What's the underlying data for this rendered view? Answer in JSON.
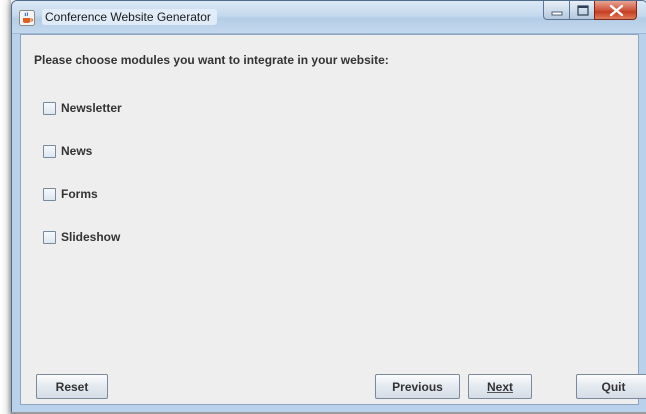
{
  "window": {
    "title": "Conference Website Generator",
    "app_icon": "java-cup-icon",
    "controls": [
      "minimize-icon",
      "maximize-icon",
      "close-icon"
    ],
    "close_color": "#c73c20"
  },
  "prompt": "Please choose modules you want to integrate in your website:",
  "modules": [
    {
      "label": "Newsletter",
      "checked": false
    },
    {
      "label": "News",
      "checked": false
    },
    {
      "label": "Forms",
      "checked": false
    },
    {
      "label": "Slideshow",
      "checked": false
    }
  ],
  "buttons": {
    "reset": "Reset",
    "previous": "Previous",
    "next": "Next",
    "quit": "Quit"
  }
}
